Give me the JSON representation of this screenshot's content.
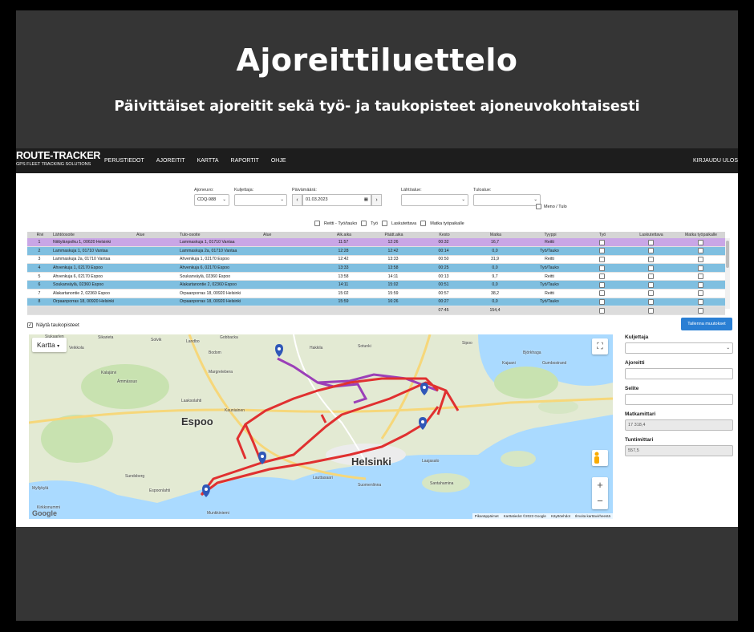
{
  "hero": {
    "title": "Ajoreittiluettelo",
    "subtitle": "Päivittäiset ajoreitit sekä työ- ja taukopisteet ajoneuvokohtaisesti"
  },
  "topbar": {
    "logo": "ROUTE-TRACKER",
    "logo_sub": "GPS FLEET TRACKING SOLUTIONS",
    "nav": [
      "PERUSTIEDOT",
      "AJOREITIT",
      "KARTTA",
      "RAPORTIT",
      "OHJE"
    ],
    "logout": "KIRJAUDU ULOS"
  },
  "filters": {
    "vehicle_label": "Ajoneuvo:",
    "vehicle_value": "CDQ-988",
    "driver_label": "Kuljettaja:",
    "driver_value": "",
    "date_label": "Päivämäärä:",
    "date_value": "01.03.2023",
    "departure_label": "Lähtöalue:",
    "departure_value": "",
    "arrival_label": "Tuloalue:",
    "arrival_value": "",
    "meno_label": "Meno / Tulo",
    "checks": [
      "Reitti - Työ/tauko",
      "Työ",
      "Laskutettava",
      "Matka työpaikalle"
    ]
  },
  "table": {
    "headers": [
      "Rivi",
      "Lähtöosoite",
      "Alue",
      "Tulo-osoite",
      "Alue",
      "Alk.aika",
      "Päätt.aika",
      "Kesto",
      "Matka",
      "Tyyppi",
      "Työ",
      "Laskutettava",
      "Matka työpaikalle"
    ],
    "rows": [
      {
        "n": "1",
        "from": "Niittylänpolku 1, 00620 Helsinki",
        "to": "Lammaskuja 1, 01710 Vantaa",
        "start": "11:57",
        "end": "12:26",
        "dur": "00:32",
        "km": "16,7",
        "type": "Reitti",
        "style": "purple"
      },
      {
        "n": "2",
        "from": "Lammaskuja 1, 01710 Vantaa",
        "to": "Lammaskuja 2a, 01710 Vantaa",
        "start": "12:28",
        "end": "12:42",
        "dur": "00:14",
        "km": "0,0",
        "type": "Työ/Tauko",
        "style": "blue"
      },
      {
        "n": "3",
        "from": "Lammaskuja 2a, 01710 Vantaa",
        "to": "Ahvenkuja 1, 02170 Espoo",
        "start": "12:42",
        "end": "13:33",
        "dur": "00:50",
        "km": "31,9",
        "type": "Reitti",
        "style": "white"
      },
      {
        "n": "4",
        "from": "Ahvenkuja 1, 02170 Espoo",
        "to": "Ahvenkuja 6, 02170 Espoo",
        "start": "13:33",
        "end": "13:58",
        "dur": "00:25",
        "km": "0,0",
        "type": "Työ/Tauko",
        "style": "blue"
      },
      {
        "n": "5",
        "from": "Ahvenkuja 6, 02170 Espoo",
        "to": "Soukanväylä, 02360 Espoo",
        "start": "13:58",
        "end": "14:11",
        "dur": "00:13",
        "km": "9,7",
        "type": "Reitti",
        "style": "white"
      },
      {
        "n": "6",
        "from": "Soukanväylä, 02360 Espoo",
        "to": "Alakartanontie 2, 02360 Espoo",
        "start": "14:11",
        "end": "15:02",
        "dur": "00:51",
        "km": "0,0",
        "type": "Työ/Tauko",
        "style": "blue"
      },
      {
        "n": "7",
        "from": "Alakartanontie 2, 02360 Espoo",
        "to": "Orpaanporras 18, 00920 Helsinki",
        "start": "15:02",
        "end": "15:59",
        "dur": "00:57",
        "km": "38,2",
        "type": "Reitti",
        "style": "white"
      },
      {
        "n": "8",
        "from": "Orpaanporras 18, 00920 Helsinki",
        "to": "Orpaanporras 18, 00920 Helsinki",
        "start": "15:59",
        "end": "16:26",
        "dur": "00:27",
        "km": "0,0",
        "type": "Työ/Tauko",
        "style": "blue"
      }
    ],
    "total_duration": "07:45",
    "total_km": "154,4"
  },
  "show_stops_label": "Näytä taukopisteet",
  "save_label": "Tallenna muutokset",
  "map": {
    "type_label": "Kartta",
    "cities": [
      "Espoo",
      "Helsinki"
    ],
    "places": [
      "Sipoo",
      "Gobbacka",
      "Sotunki",
      "Sikarieta",
      "Solvik",
      "Landbo",
      "Veikkola",
      "Bodom",
      "Kalajärvi",
      "Ämmässuo",
      "Margretebera",
      "Hakkila",
      "Laaksolahti",
      "Kauniainen",
      "Kirkkonummi",
      "Sundsberg",
      "Myllykylä",
      "Lauttasaari",
      "Suomenlinna",
      "Laajasalo",
      "Santahamina",
      "Munkkiniemi",
      "Espoonlahti",
      "Björkhaga",
      "Gumbostrand",
      "Kajaani",
      "Siukaarlen"
    ],
    "attribution": [
      "Pikanäppäimet",
      "Karttatiedot ©2023 Google",
      "Käyttöehdot",
      "Ilmoita karttavirheestä"
    ],
    "google": "Google"
  },
  "side": {
    "driver_label": "Kuljettaja",
    "route_label": "Ajoreitti",
    "note_label": "Selite",
    "odometer_label": "Matkamittari",
    "odometer_value": "17 318,4",
    "hourmeter_label": "Tuntimittari",
    "hourmeter_value": "557,5"
  },
  "colors": {
    "frame": "#353535",
    "topbar": "#1d1d1d",
    "row_purple": "#c9a6e6",
    "row_blue": "#7fbfe0",
    "route_red": "#e03030",
    "route_purple": "#9b3fb8",
    "save_button": "#2a7fd4"
  }
}
